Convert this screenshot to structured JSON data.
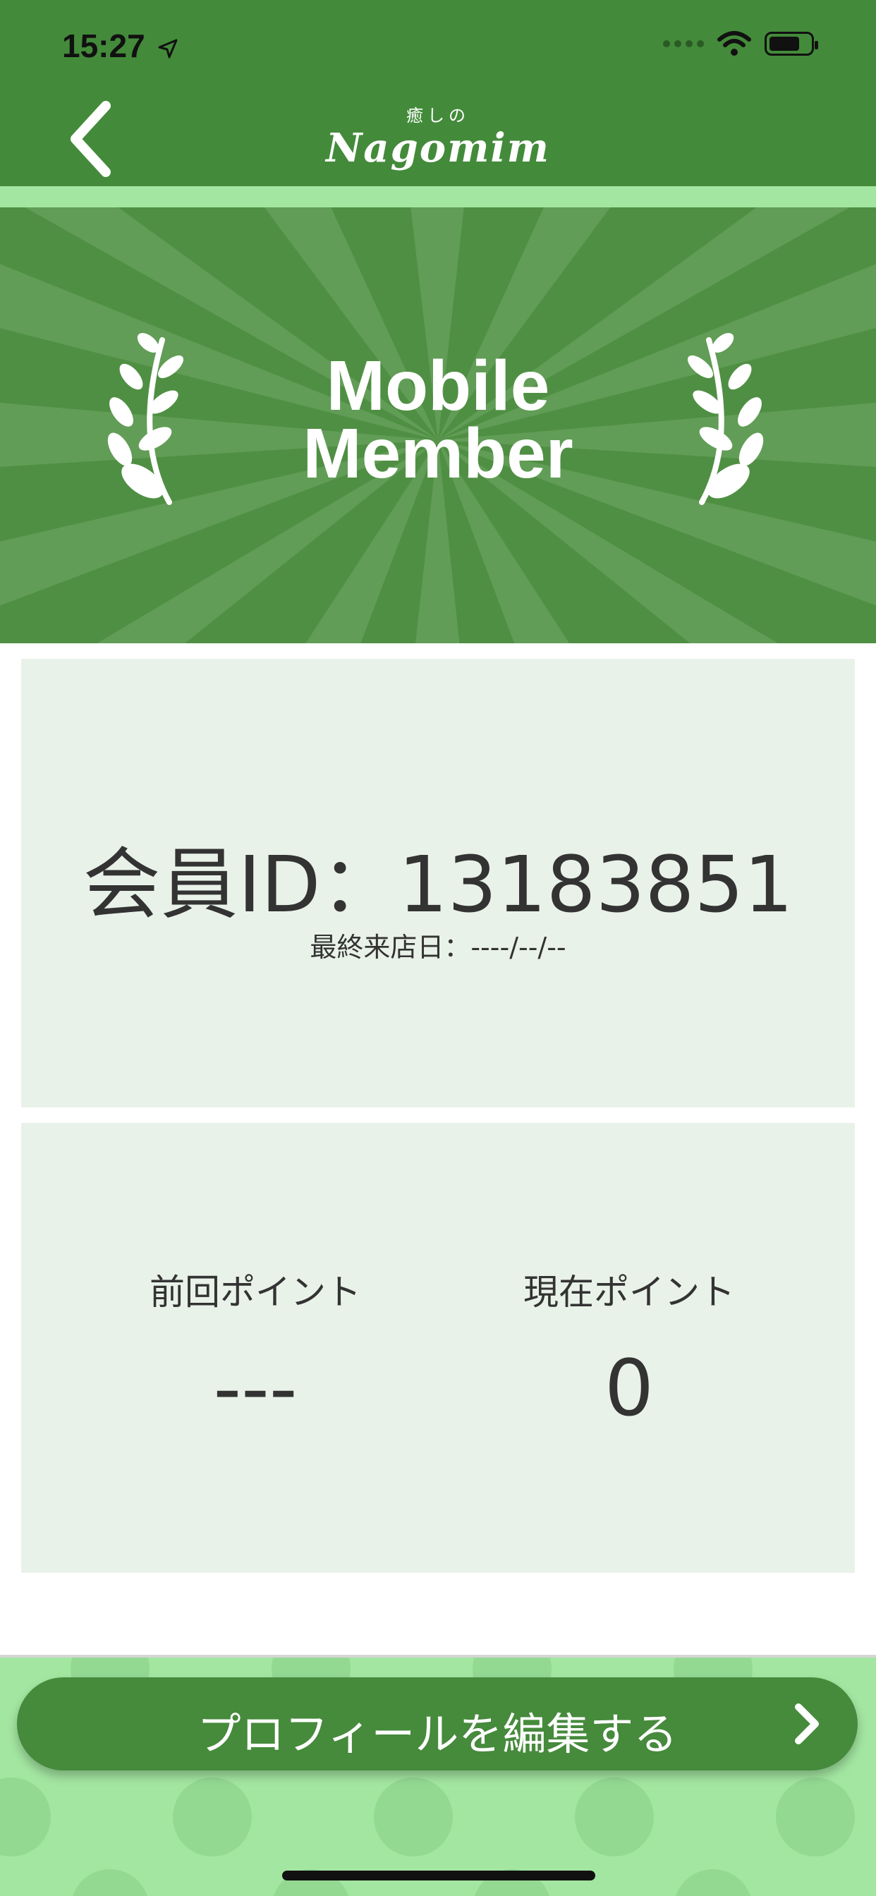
{
  "status_bar": {
    "time": "15:27"
  },
  "header": {
    "logo_sub": "癒しの",
    "logo_main": "Nagomim"
  },
  "banner": {
    "title_line1": "Mobile",
    "title_line2": "Member"
  },
  "member": {
    "id_text": "会員ID：13183851",
    "last_visit_text": "最終来店日：----/--/--"
  },
  "points": {
    "previous_label": "前回ポイント",
    "previous_value": "---",
    "current_label": "現在ポイント",
    "current_value": "0"
  },
  "footer": {
    "edit_profile_label": "プロフィールを編集する"
  },
  "colors": {
    "primary_green": "#438b3a",
    "light_green": "#a3e6a1",
    "card_bg": "#e9f2e9"
  },
  "icons": [
    "back-chevron-icon",
    "location-arrow-icon",
    "wifi-icon",
    "battery-icon",
    "laurel-icon",
    "chevron-right-icon"
  ]
}
